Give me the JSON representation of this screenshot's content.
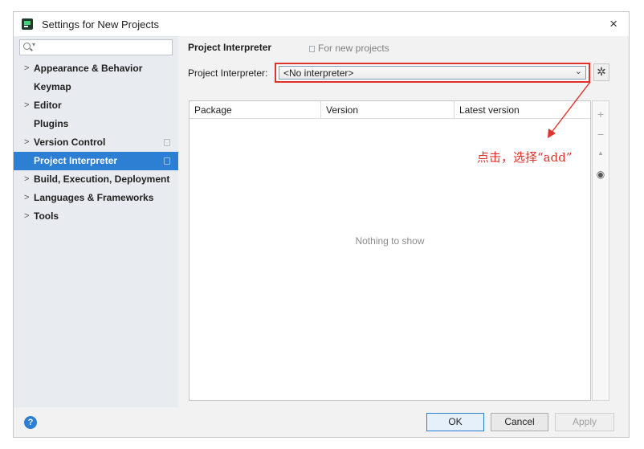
{
  "window": {
    "title": "Settings for New Projects",
    "close_glyph": "×"
  },
  "sidebar": {
    "search": {
      "value": "",
      "icon": "search-icon"
    },
    "items": [
      {
        "label": "Appearance & Behavior",
        "chevron": ">",
        "selected": false
      },
      {
        "label": "Keymap",
        "chevron": "",
        "selected": false
      },
      {
        "label": "Editor",
        "chevron": ">",
        "selected": false
      },
      {
        "label": "Plugins",
        "chevron": "",
        "selected": false
      },
      {
        "label": "Version Control",
        "chevron": ">",
        "selected": false
      },
      {
        "label": "Project Interpreter",
        "chevron": "",
        "selected": true
      },
      {
        "label": "Build, Execution, Deployment",
        "chevron": ">",
        "selected": false
      },
      {
        "label": "Languages & Frameworks",
        "chevron": ">",
        "selected": false
      },
      {
        "label": "Tools",
        "chevron": ">",
        "selected": false
      }
    ]
  },
  "main": {
    "heading": "Project Interpreter",
    "scope_note": "For new projects",
    "interpreter_label": "Project Interpreter:",
    "interpreter_value": "<No interpreter>",
    "table": {
      "columns": [
        "Package",
        "Version",
        "Latest version"
      ],
      "rows": [],
      "empty_text": "Nothing to show"
    },
    "side_tools": [
      {
        "icon": "plus-icon",
        "glyph": "+"
      },
      {
        "icon": "minus-icon",
        "glyph": "−"
      },
      {
        "icon": "arrow-up-icon",
        "glyph": "▲"
      },
      {
        "icon": "eye-icon",
        "glyph": "◉"
      }
    ]
  },
  "annotation": {
    "text": "点击，选择“add”",
    "color": "#e0312b"
  },
  "footer": {
    "help": "?",
    "ok": "OK",
    "cancel": "Cancel",
    "apply": "Apply"
  },
  "colors": {
    "selection": "#2d7fd3",
    "highlight": "#e0312b",
    "sidebar_bg": "#e8ecf1"
  }
}
